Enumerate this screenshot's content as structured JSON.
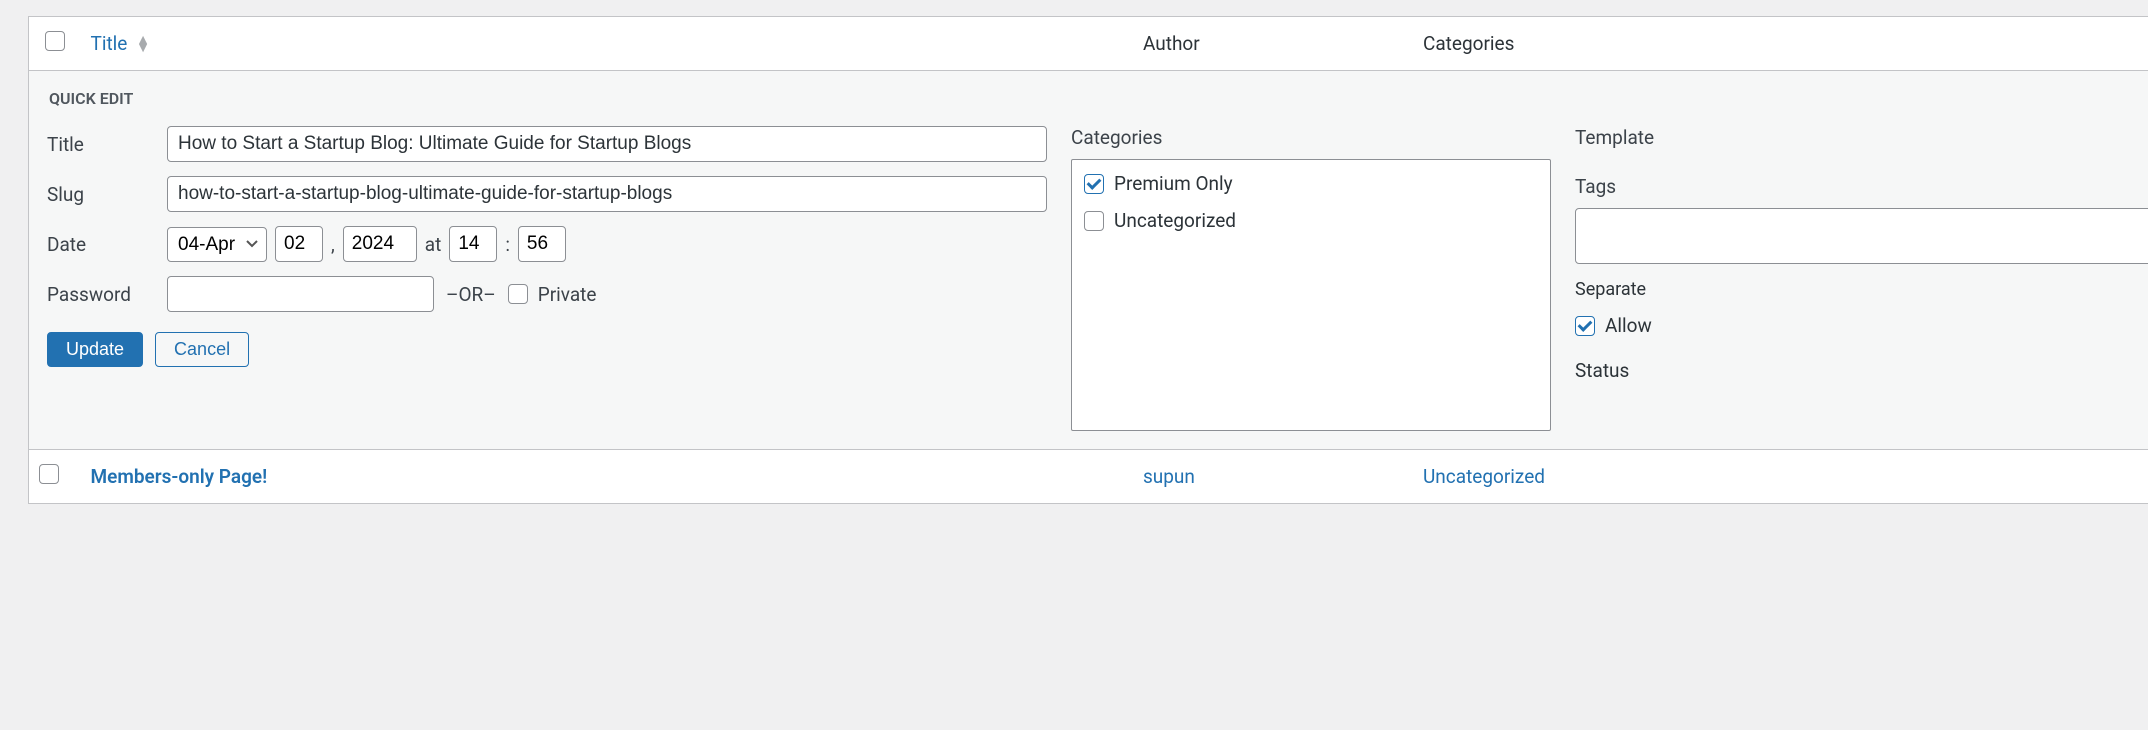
{
  "table": {
    "header_title": "Title",
    "header_author": "Author",
    "header_categories": "Categories"
  },
  "quickEdit": {
    "legend": "QUICK EDIT",
    "labels": {
      "title": "Title",
      "slug": "Slug",
      "date": "Date",
      "password": "Password",
      "at": "at",
      "or": "–OR–",
      "private": "Private",
      "comma": ",",
      "colon": ":"
    },
    "fields": {
      "title": "How to Start a Startup Blog: Ultimate Guide for Startup Blogs",
      "slug": "how-to-start-a-startup-blog-ultimate-guide-for-startup-blogs",
      "month": "04-Apr",
      "day": "02",
      "year": "2024",
      "hour": "14",
      "minute": "56",
      "password": ""
    },
    "categoriesHeading": "Categories",
    "categories": [
      {
        "label": "Premium Only",
        "checked": true
      },
      {
        "label": "Uncategorized",
        "checked": false
      }
    ],
    "right": {
      "templateHeading": "Template",
      "tagsHeading": "Tags",
      "separateHint": "Separate",
      "allowLabel": "Allow",
      "statusLabel": "Status"
    },
    "buttons": {
      "update": "Update",
      "cancel": "Cancel"
    }
  },
  "postRow": {
    "title": "Members-only Page!",
    "author": "supun",
    "category": "Uncategorized"
  }
}
